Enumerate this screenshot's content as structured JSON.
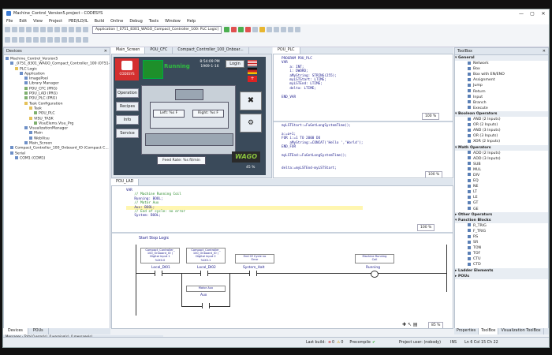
{
  "window": {
    "title": "Machine_Control_Version5.project - CODESYS",
    "controls": [
      "—",
      "▢",
      "✕"
    ]
  },
  "menu": [
    "File",
    "Edit",
    "View",
    "Project",
    "PBD/LD/IL",
    "Build",
    "Online",
    "Debug",
    "Tools",
    "Window",
    "Help"
  ],
  "toolbar": {
    "application": "Application [_0751_8301_WAGO_Compact_Controller_100: PLC Logic]"
  },
  "devices": {
    "title": "Devices",
    "tree": [
      {
        "text": "Machine_Control_Version5",
        "level": 0,
        "icon": "project-icon"
      },
      {
        "text": "_0751_8301_WAGO_Compact_Controller_100 (0751-8...",
        "level": 1,
        "icon": "controller-icon"
      },
      {
        "text": "PLC Logic",
        "level": 2,
        "icon": "folder-icon"
      },
      {
        "text": "Application",
        "level": 3,
        "icon": "application-icon"
      },
      {
        "text": "ImagePool",
        "level": 4,
        "icon": "imagepool-icon"
      },
      {
        "text": "Library Manager",
        "level": 4,
        "icon": "library-icon"
      },
      {
        "text": "POU_CFC (PRG)",
        "level": 4,
        "icon": "pou-icon"
      },
      {
        "text": "POU_LAD (PRG)",
        "level": 4,
        "icon": "pou-icon"
      },
      {
        "text": "POU_PLC (PRG)",
        "level": 4,
        "icon": "pou-icon"
      },
      {
        "text": "Task Configuration",
        "level": 4,
        "icon": "task-icon"
      },
      {
        "text": "Task",
        "level": 5,
        "icon": "task-icon"
      },
      {
        "text": "POU_PLC",
        "level": 6,
        "icon": "pou-icon"
      },
      {
        "text": "VISU_TASK",
        "level": 5,
        "icon": "task-icon"
      },
      {
        "text": "VisuElems.Visu_Prg",
        "level": 6,
        "icon": "pou-icon"
      },
      {
        "text": "VisualizationManager",
        "level": 4,
        "icon": "visu-icon"
      },
      {
        "text": "Main",
        "level": 5,
        "icon": "visu-icon"
      },
      {
        "text": "WebVisu",
        "level": 5,
        "icon": "visu-icon"
      },
      {
        "text": "Main_Screen",
        "level": 4,
        "icon": "visu-icon"
      },
      {
        "text": "Compact_Controller_100_Onboard_IO (Compact C...",
        "level": 1,
        "icon": "io-icon"
      },
      {
        "text": "Serial",
        "level": 1,
        "icon": "serial-icon"
      },
      {
        "text": "COM1 (COM1)",
        "level": 2,
        "icon": "port-icon"
      }
    ],
    "bottom_tabs": [
      "Devices",
      "POUs"
    ]
  },
  "top_tabs": [
    "Main_Screen",
    "POU_CFC",
    "Compact_Controller_100_Onboar..."
  ],
  "hmi": {
    "status": "Running",
    "time": "8:54:09 PM",
    "date": "1969-1-16",
    "login": "Login",
    "buttons": [
      "Operation",
      "Recipes",
      "Info",
      "Service"
    ],
    "left_temp": "Left: %s F",
    "right_temp": "Right: %s F",
    "feed_rate": "Feed Rate: %s ft/min",
    "brand": "WAGO",
    "percent": "45 %",
    "logo": "CODESYS"
  },
  "pou_plc": {
    "tab": "POU_PLC",
    "decl": [
      "PROGRAM POU_PLC",
      "VAR",
      "    a: INT;",
      "    i: DWORD;",
      "    aMyString: STRING(255);",
      "    myLSTStart: LTIME;",
      "    myLSTEnd: LTIME;",
      "    delta: LTIME;",
      "",
      "END_VAR"
    ],
    "decl_zoom": "100 %",
    "impl": [
      "myLSTStart:=FuGetLongSystemTime();",
      "",
      "a:=a+1;",
      "FOR i:=1 TO 2000 DO",
      "    aMyString:=CONCAT('Hello ','World');",
      "END_FOR",
      "",
      "myLSTEnd:=FuGetLongSystemTime();",
      "",
      "",
      "delta:=myLSTEnd-myLSTStart;"
    ],
    "impl_zoom": "100 %"
  },
  "pou_lad": {
    "tab": "POU_LAD",
    "decl": [
      "VAR",
      "    // Machine Running Coil",
      "    Running: BOOL;",
      "    // Motor Aux",
      "    Aux: BOOL;",
      "    // End of cycle: no error",
      "    System: BOOL;"
    ],
    "decl_zoom": "100 %",
    "net_title": "Start Stop Logic",
    "boxes": [
      {
        "lines": [
          "Compact_Controller_",
          "100_Onboard_IO (",
          "Digital input 1",
          "%IX0.0"
        ]
      },
      {
        "lines": [
          "Compact_Controller_",
          "100_Onboard_IO (",
          "Digital input 2",
          "%IX0.1"
        ]
      },
      {
        "lines": [
          "End Of Cycle no",
          "Error"
        ]
      },
      {
        "lines": [
          "Machine Running",
          "Coil"
        ]
      },
      {
        "lines": [
          "Motor Aux"
        ]
      }
    ],
    "vars": {
      "c1": "Local_DI01",
      "c2": "Local_DI02",
      "c3": "System_Halt",
      "coil": "Running",
      "aux": "Aux"
    },
    "zoom": "85 %"
  },
  "toolbox": {
    "title": "ToolBox",
    "sections": [
      {
        "name": "General",
        "items": [
          "Network",
          "Box",
          "Box with EN/ENO",
          "Assignment",
          "Jump",
          "Return",
          "Input",
          "Branch",
          "Execute"
        ]
      },
      {
        "name": "Boolean Operators",
        "items": [
          "AND (2 Inputs)",
          "OR (2 Inputs)",
          "AND (3 Inputs)",
          "OR (3 Inputs)",
          "XOR (2 Inputs)"
        ]
      },
      {
        "name": "Math Operators",
        "items": [
          "ADD (2 Inputs)",
          "ADD (3 Inputs)",
          "SUB",
          "MUL",
          "DIV",
          "EQ",
          "NE",
          "LT",
          "LE",
          "GT",
          "GE"
        ]
      },
      {
        "name": "Other Operators",
        "items": []
      },
      {
        "name": "Function Blocks",
        "items": [
          "R_TRIG",
          "F_TRIG",
          "RS",
          "SR",
          "TON",
          "TOF",
          "CTU",
          "CTD"
        ]
      },
      {
        "name": "Ladder Elements",
        "items": []
      },
      {
        "name": "POUs",
        "items": []
      }
    ],
    "bottom_tabs": [
      "Properties",
      "ToolBox",
      "Visualization ToolBox"
    ]
  },
  "statusbar": {
    "messages": "Messages - Total 0 error(s), 0 warning(s), 0 message(s)",
    "last_build": "Last build:",
    "errors": "0",
    "warnings": "0",
    "precompile": "Precompile",
    "user": "Project user: (nobody)",
    "ins": "INS",
    "pos": "Ln 6   Col 15   Ch 22"
  },
  "colors": {
    "hmi_bg": "#3a4a5a",
    "running": "#2fbf3f",
    "accent": "#2d7dd2"
  }
}
